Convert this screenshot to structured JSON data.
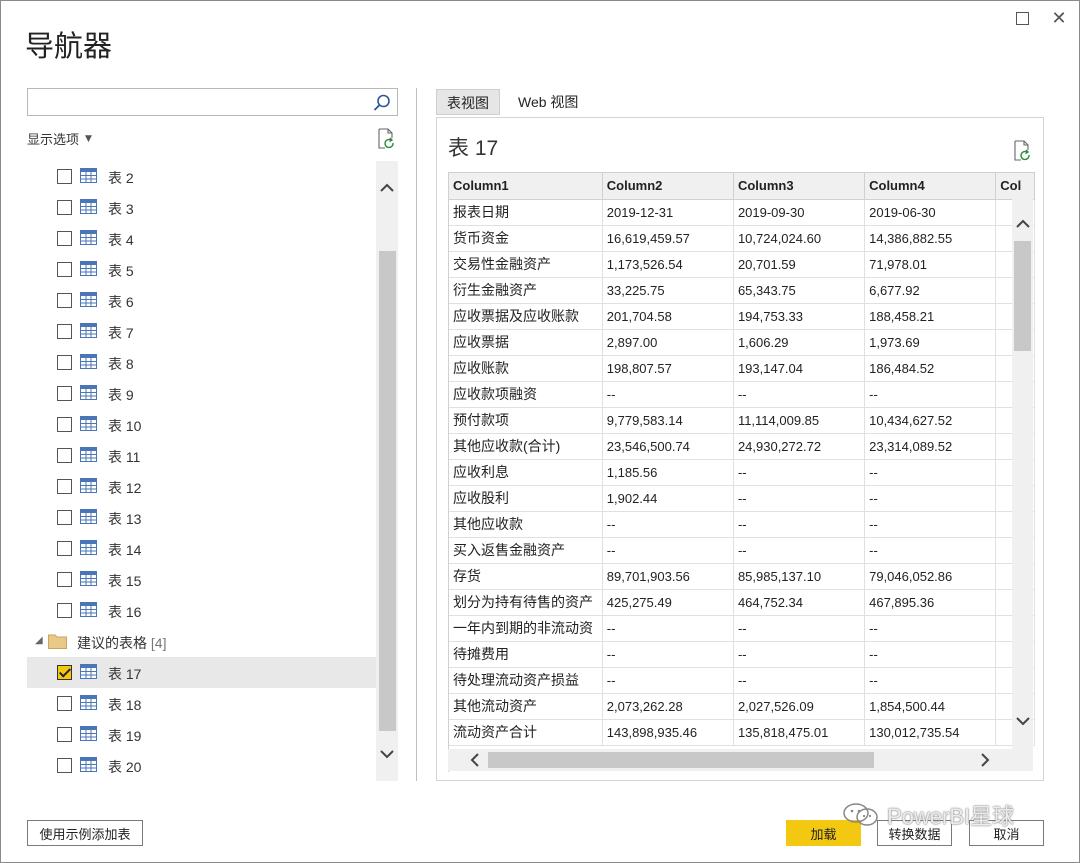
{
  "window": {
    "title": "导航器",
    "maximize_icon": "maximize-icon",
    "close_icon": "close-icon",
    "close_glyph": "✕"
  },
  "left_pane": {
    "search": {
      "placeholder": "",
      "value": ""
    },
    "display_options_label": "显示选项",
    "tables": [
      {
        "label": "表 2",
        "checked": false
      },
      {
        "label": "表 3",
        "checked": false
      },
      {
        "label": "表 4",
        "checked": false
      },
      {
        "label": "表 5",
        "checked": false
      },
      {
        "label": "表 6",
        "checked": false
      },
      {
        "label": "表 7",
        "checked": false
      },
      {
        "label": "表 8",
        "checked": false
      },
      {
        "label": "表 9",
        "checked": false
      },
      {
        "label": "表 10",
        "checked": false
      },
      {
        "label": "表 11",
        "checked": false
      },
      {
        "label": "表 12",
        "checked": false
      },
      {
        "label": "表 13",
        "checked": false
      },
      {
        "label": "表 14",
        "checked": false
      },
      {
        "label": "表 15",
        "checked": false
      },
      {
        "label": "表 16",
        "checked": false
      }
    ],
    "folder": {
      "label": "建议的表格",
      "count": "[4]"
    },
    "suggested_tables": [
      {
        "label": "表 17",
        "checked": true
      },
      {
        "label": "表 18",
        "checked": false
      },
      {
        "label": "表 19",
        "checked": false
      },
      {
        "label": "表 20",
        "checked": false
      }
    ]
  },
  "right_pane": {
    "tabs": [
      {
        "label": "表视图",
        "active": true
      },
      {
        "label": "Web 视图",
        "active": false
      }
    ],
    "preview_title": "表 17",
    "columns": [
      "Column1",
      "Column2",
      "Column3",
      "Column4",
      "Col"
    ],
    "rows": [
      [
        "报表日期",
        "2019-12-31",
        "2019-09-30",
        "2019-06-30",
        ""
      ],
      [
        "货币资金",
        "16,619,459.57",
        "10,724,024.60",
        "14,386,882.55",
        ""
      ],
      [
        "交易性金融资产",
        "1,173,526.54",
        "20,701.59",
        "71,978.01",
        ""
      ],
      [
        "衍生金融资产",
        "33,225.75",
        "65,343.75",
        "6,677.92",
        ""
      ],
      [
        "应收票据及应收账款",
        "201,704.58",
        "194,753.33",
        "188,458.21",
        ""
      ],
      [
        "应收票据",
        "2,897.00",
        "1,606.29",
        "1,973.69",
        ""
      ],
      [
        "应收账款",
        "198,807.57",
        "193,147.04",
        "186,484.52",
        ""
      ],
      [
        "应收款项融资",
        "--",
        "--",
        "--",
        ""
      ],
      [
        "预付款项",
        "9,779,583.14",
        "11,114,009.85",
        "10,434,627.52",
        ""
      ],
      [
        "其他应收款(合计)",
        "23,546,500.74",
        "24,930,272.72",
        "23,314,089.52",
        ""
      ],
      [
        "应收利息",
        "1,185.56",
        "--",
        "--",
        ""
      ],
      [
        "应收股利",
        "1,902.44",
        "--",
        "--",
        ""
      ],
      [
        "其他应收款",
        "--",
        "--",
        "--",
        ""
      ],
      [
        "买入返售金融资产",
        "--",
        "--",
        "--",
        ""
      ],
      [
        "存货",
        "89,701,903.56",
        "85,985,137.10",
        "79,046,052.86",
        ""
      ],
      [
        "划分为持有待售的资产",
        "425,275.49",
        "464,752.34",
        "467,895.36",
        ""
      ],
      [
        "一年内到期的非流动资",
        "--",
        "--",
        "--",
        ""
      ],
      [
        "待摊费用",
        "--",
        "--",
        "--",
        ""
      ],
      [
        "待处理流动资产损益",
        "--",
        "--",
        "--",
        ""
      ],
      [
        "其他流动资产",
        "2,073,262.28",
        "2,027,526.09",
        "1,854,500.44",
        ""
      ],
      [
        "流动资产合计",
        "143,898,935.46",
        "135,818,475.01",
        "130,012,735.54",
        ""
      ]
    ]
  },
  "buttons": {
    "add_from_example": "使用示例添加表",
    "load": "加载",
    "transform": "转换数据",
    "cancel": "取消"
  },
  "watermark": {
    "text": "PowerBI星球"
  },
  "colors": {
    "accent": "#f2c811",
    "border": "#8a8a8a",
    "selected_row": "#e8e8e8"
  }
}
